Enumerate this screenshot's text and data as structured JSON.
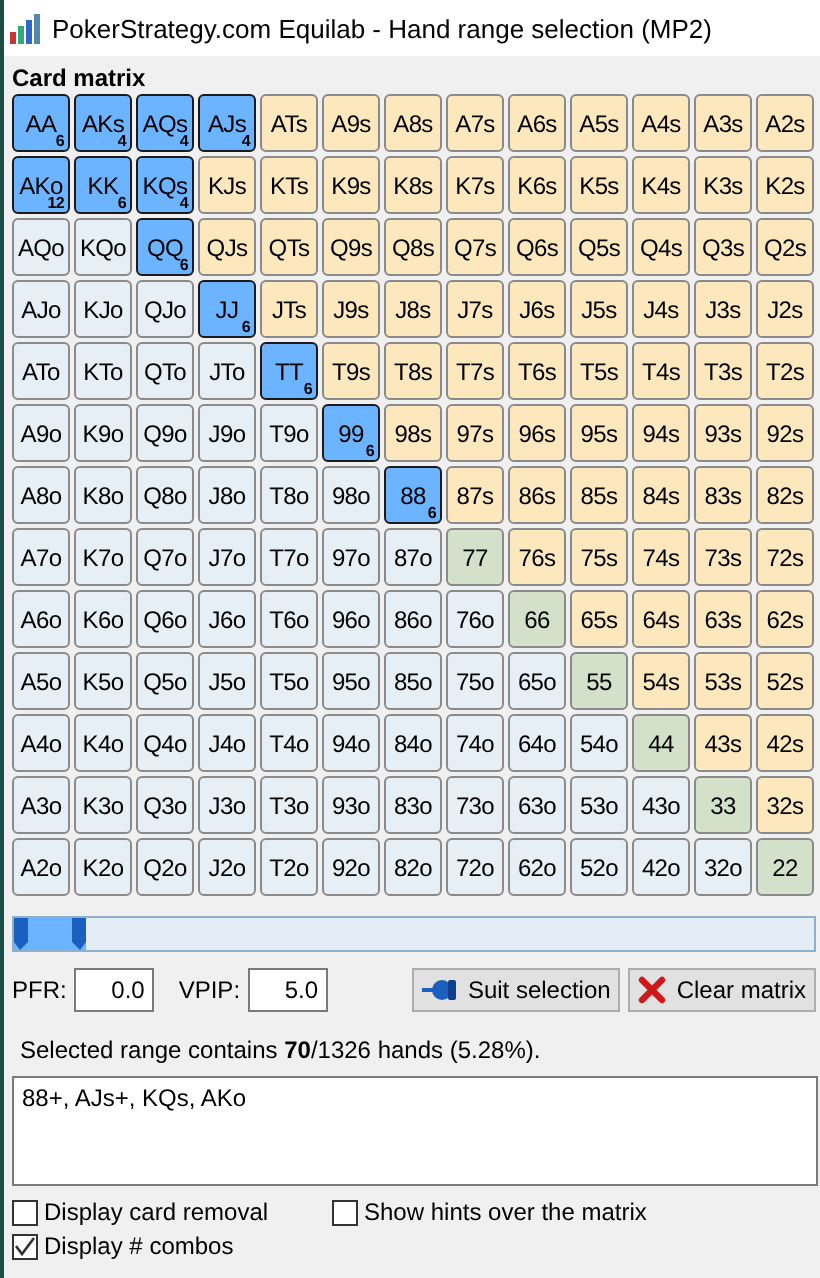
{
  "window": {
    "title": "PokerStrategy.com Equilab - Hand range selection (MP2)"
  },
  "matrix": {
    "heading": "Card matrix",
    "rows": [
      {
        "cells": [
          {
            "label": "AA",
            "kind": "pair",
            "selected": true,
            "combos": "6"
          },
          {
            "label": "AKs",
            "kind": "suited",
            "selected": true,
            "combos": "4"
          },
          {
            "label": "AQs",
            "kind": "suited",
            "selected": true,
            "combos": "4"
          },
          {
            "label": "AJs",
            "kind": "suited",
            "selected": true,
            "combos": "4"
          },
          {
            "label": "ATs",
            "kind": "suited",
            "selected": false
          },
          {
            "label": "A9s",
            "kind": "suited",
            "selected": false
          },
          {
            "label": "A8s",
            "kind": "suited",
            "selected": false
          },
          {
            "label": "A7s",
            "kind": "suited",
            "selected": false
          },
          {
            "label": "A6s",
            "kind": "suited",
            "selected": false
          },
          {
            "label": "A5s",
            "kind": "suited",
            "selected": false
          },
          {
            "label": "A4s",
            "kind": "suited",
            "selected": false
          },
          {
            "label": "A3s",
            "kind": "suited",
            "selected": false
          },
          {
            "label": "A2s",
            "kind": "suited",
            "selected": false
          }
        ]
      },
      {
        "cells": [
          {
            "label": "AKo",
            "kind": "offsuit",
            "selected": true,
            "combos": "12"
          },
          {
            "label": "KK",
            "kind": "pair",
            "selected": true,
            "combos": "6"
          },
          {
            "label": "KQs",
            "kind": "suited",
            "selected": true,
            "combos": "4"
          },
          {
            "label": "KJs",
            "kind": "suited",
            "selected": false
          },
          {
            "label": "KTs",
            "kind": "suited",
            "selected": false
          },
          {
            "label": "K9s",
            "kind": "suited",
            "selected": false
          },
          {
            "label": "K8s",
            "kind": "suited",
            "selected": false
          },
          {
            "label": "K7s",
            "kind": "suited",
            "selected": false
          },
          {
            "label": "K6s",
            "kind": "suited",
            "selected": false
          },
          {
            "label": "K5s",
            "kind": "suited",
            "selected": false
          },
          {
            "label": "K4s",
            "kind": "suited",
            "selected": false
          },
          {
            "label": "K3s",
            "kind": "suited",
            "selected": false
          },
          {
            "label": "K2s",
            "kind": "suited",
            "selected": false
          }
        ]
      },
      {
        "cells": [
          {
            "label": "AQo",
            "kind": "offsuit",
            "selected": false
          },
          {
            "label": "KQo",
            "kind": "offsuit",
            "selected": false
          },
          {
            "label": "QQ",
            "kind": "pair",
            "selected": true,
            "combos": "6"
          },
          {
            "label": "QJs",
            "kind": "suited",
            "selected": false
          },
          {
            "label": "QTs",
            "kind": "suited",
            "selected": false
          },
          {
            "label": "Q9s",
            "kind": "suited",
            "selected": false
          },
          {
            "label": "Q8s",
            "kind": "suited",
            "selected": false
          },
          {
            "label": "Q7s",
            "kind": "suited",
            "selected": false
          },
          {
            "label": "Q6s",
            "kind": "suited",
            "selected": false
          },
          {
            "label": "Q5s",
            "kind": "suited",
            "selected": false
          },
          {
            "label": "Q4s",
            "kind": "suited",
            "selected": false
          },
          {
            "label": "Q3s",
            "kind": "suited",
            "selected": false
          },
          {
            "label": "Q2s",
            "kind": "suited",
            "selected": false
          }
        ]
      },
      {
        "cells": [
          {
            "label": "AJo",
            "kind": "offsuit",
            "selected": false
          },
          {
            "label": "KJo",
            "kind": "offsuit",
            "selected": false
          },
          {
            "label": "QJo",
            "kind": "offsuit",
            "selected": false
          },
          {
            "label": "JJ",
            "kind": "pair",
            "selected": true,
            "combos": "6"
          },
          {
            "label": "JTs",
            "kind": "suited",
            "selected": false
          },
          {
            "label": "J9s",
            "kind": "suited",
            "selected": false
          },
          {
            "label": "J8s",
            "kind": "suited",
            "selected": false
          },
          {
            "label": "J7s",
            "kind": "suited",
            "selected": false
          },
          {
            "label": "J6s",
            "kind": "suited",
            "selected": false
          },
          {
            "label": "J5s",
            "kind": "suited",
            "selected": false
          },
          {
            "label": "J4s",
            "kind": "suited",
            "selected": false
          },
          {
            "label": "J3s",
            "kind": "suited",
            "selected": false
          },
          {
            "label": "J2s",
            "kind": "suited",
            "selected": false
          }
        ]
      },
      {
        "cells": [
          {
            "label": "ATo",
            "kind": "offsuit",
            "selected": false
          },
          {
            "label": "KTo",
            "kind": "offsuit",
            "selected": false
          },
          {
            "label": "QTo",
            "kind": "offsuit",
            "selected": false
          },
          {
            "label": "JTo",
            "kind": "offsuit",
            "selected": false
          },
          {
            "label": "TT",
            "kind": "pair",
            "selected": true,
            "combos": "6"
          },
          {
            "label": "T9s",
            "kind": "suited",
            "selected": false
          },
          {
            "label": "T8s",
            "kind": "suited",
            "selected": false
          },
          {
            "label": "T7s",
            "kind": "suited",
            "selected": false
          },
          {
            "label": "T6s",
            "kind": "suited",
            "selected": false
          },
          {
            "label": "T5s",
            "kind": "suited",
            "selected": false
          },
          {
            "label": "T4s",
            "kind": "suited",
            "selected": false
          },
          {
            "label": "T3s",
            "kind": "suited",
            "selected": false
          },
          {
            "label": "T2s",
            "kind": "suited",
            "selected": false
          }
        ]
      },
      {
        "cells": [
          {
            "label": "A9o",
            "kind": "offsuit",
            "selected": false
          },
          {
            "label": "K9o",
            "kind": "offsuit",
            "selected": false
          },
          {
            "label": "Q9o",
            "kind": "offsuit",
            "selected": false
          },
          {
            "label": "J9o",
            "kind": "offsuit",
            "selected": false
          },
          {
            "label": "T9o",
            "kind": "offsuit",
            "selected": false
          },
          {
            "label": "99",
            "kind": "pair",
            "selected": true,
            "combos": "6"
          },
          {
            "label": "98s",
            "kind": "suited",
            "selected": false
          },
          {
            "label": "97s",
            "kind": "suited",
            "selected": false
          },
          {
            "label": "96s",
            "kind": "suited",
            "selected": false
          },
          {
            "label": "95s",
            "kind": "suited",
            "selected": false
          },
          {
            "label": "94s",
            "kind": "suited",
            "selected": false
          },
          {
            "label": "93s",
            "kind": "suited",
            "selected": false
          },
          {
            "label": "92s",
            "kind": "suited",
            "selected": false
          }
        ]
      },
      {
        "cells": [
          {
            "label": "A8o",
            "kind": "offsuit",
            "selected": false
          },
          {
            "label": "K8o",
            "kind": "offsuit",
            "selected": false
          },
          {
            "label": "Q8o",
            "kind": "offsuit",
            "selected": false
          },
          {
            "label": "J8o",
            "kind": "offsuit",
            "selected": false
          },
          {
            "label": "T8o",
            "kind": "offsuit",
            "selected": false
          },
          {
            "label": "98o",
            "kind": "offsuit",
            "selected": false
          },
          {
            "label": "88",
            "kind": "pair",
            "selected": true,
            "combos": "6"
          },
          {
            "label": "87s",
            "kind": "suited",
            "selected": false
          },
          {
            "label": "86s",
            "kind": "suited",
            "selected": false
          },
          {
            "label": "85s",
            "kind": "suited",
            "selected": false
          },
          {
            "label": "84s",
            "kind": "suited",
            "selected": false
          },
          {
            "label": "83s",
            "kind": "suited",
            "selected": false
          },
          {
            "label": "82s",
            "kind": "suited",
            "selected": false
          }
        ]
      },
      {
        "cells": [
          {
            "label": "A7o",
            "kind": "offsuit",
            "selected": false
          },
          {
            "label": "K7o",
            "kind": "offsuit",
            "selected": false
          },
          {
            "label": "Q7o",
            "kind": "offsuit",
            "selected": false
          },
          {
            "label": "J7o",
            "kind": "offsuit",
            "selected": false
          },
          {
            "label": "T7o",
            "kind": "offsuit",
            "selected": false
          },
          {
            "label": "97o",
            "kind": "offsuit",
            "selected": false
          },
          {
            "label": "87o",
            "kind": "offsuit",
            "selected": false
          },
          {
            "label": "77",
            "kind": "pair",
            "selected": false
          },
          {
            "label": "76s",
            "kind": "suited",
            "selected": false
          },
          {
            "label": "75s",
            "kind": "suited",
            "selected": false
          },
          {
            "label": "74s",
            "kind": "suited",
            "selected": false
          },
          {
            "label": "73s",
            "kind": "suited",
            "selected": false
          },
          {
            "label": "72s",
            "kind": "suited",
            "selected": false
          }
        ]
      },
      {
        "cells": [
          {
            "label": "A6o",
            "kind": "offsuit",
            "selected": false
          },
          {
            "label": "K6o",
            "kind": "offsuit",
            "selected": false
          },
          {
            "label": "Q6o",
            "kind": "offsuit",
            "selected": false
          },
          {
            "label": "J6o",
            "kind": "offsuit",
            "selected": false
          },
          {
            "label": "T6o",
            "kind": "offsuit",
            "selected": false
          },
          {
            "label": "96o",
            "kind": "offsuit",
            "selected": false
          },
          {
            "label": "86o",
            "kind": "offsuit",
            "selected": false
          },
          {
            "label": "76o",
            "kind": "offsuit",
            "selected": false
          },
          {
            "label": "66",
            "kind": "pair",
            "selected": false
          },
          {
            "label": "65s",
            "kind": "suited",
            "selected": false
          },
          {
            "label": "64s",
            "kind": "suited",
            "selected": false
          },
          {
            "label": "63s",
            "kind": "suited",
            "selected": false
          },
          {
            "label": "62s",
            "kind": "suited",
            "selected": false
          }
        ]
      },
      {
        "cells": [
          {
            "label": "A5o",
            "kind": "offsuit",
            "selected": false
          },
          {
            "label": "K5o",
            "kind": "offsuit",
            "selected": false
          },
          {
            "label": "Q5o",
            "kind": "offsuit",
            "selected": false
          },
          {
            "label": "J5o",
            "kind": "offsuit",
            "selected": false
          },
          {
            "label": "T5o",
            "kind": "offsuit",
            "selected": false
          },
          {
            "label": "95o",
            "kind": "offsuit",
            "selected": false
          },
          {
            "label": "85o",
            "kind": "offsuit",
            "selected": false
          },
          {
            "label": "75o",
            "kind": "offsuit",
            "selected": false
          },
          {
            "label": "65o",
            "kind": "offsuit",
            "selected": false
          },
          {
            "label": "55",
            "kind": "pair",
            "selected": false
          },
          {
            "label": "54s",
            "kind": "suited",
            "selected": false
          },
          {
            "label": "53s",
            "kind": "suited",
            "selected": false
          },
          {
            "label": "52s",
            "kind": "suited",
            "selected": false
          }
        ]
      },
      {
        "cells": [
          {
            "label": "A4o",
            "kind": "offsuit",
            "selected": false
          },
          {
            "label": "K4o",
            "kind": "offsuit",
            "selected": false
          },
          {
            "label": "Q4o",
            "kind": "offsuit",
            "selected": false
          },
          {
            "label": "J4o",
            "kind": "offsuit",
            "selected": false
          },
          {
            "label": "T4o",
            "kind": "offsuit",
            "selected": false
          },
          {
            "label": "94o",
            "kind": "offsuit",
            "selected": false
          },
          {
            "label": "84o",
            "kind": "offsuit",
            "selected": false
          },
          {
            "label": "74o",
            "kind": "offsuit",
            "selected": false
          },
          {
            "label": "64o",
            "kind": "offsuit",
            "selected": false
          },
          {
            "label": "54o",
            "kind": "offsuit",
            "selected": false
          },
          {
            "label": "44",
            "kind": "pair",
            "selected": false
          },
          {
            "label": "43s",
            "kind": "suited",
            "selected": false
          },
          {
            "label": "42s",
            "kind": "suited",
            "selected": false
          }
        ]
      },
      {
        "cells": [
          {
            "label": "A3o",
            "kind": "offsuit",
            "selected": false
          },
          {
            "label": "K3o",
            "kind": "offsuit",
            "selected": false
          },
          {
            "label": "Q3o",
            "kind": "offsuit",
            "selected": false
          },
          {
            "label": "J3o",
            "kind": "offsuit",
            "selected": false
          },
          {
            "label": "T3o",
            "kind": "offsuit",
            "selected": false
          },
          {
            "label": "93o",
            "kind": "offsuit",
            "selected": false
          },
          {
            "label": "83o",
            "kind": "offsuit",
            "selected": false
          },
          {
            "label": "73o",
            "kind": "offsuit",
            "selected": false
          },
          {
            "label": "63o",
            "kind": "offsuit",
            "selected": false
          },
          {
            "label": "53o",
            "kind": "offsuit",
            "selected": false
          },
          {
            "label": "43o",
            "kind": "offsuit",
            "selected": false
          },
          {
            "label": "33",
            "kind": "pair",
            "selected": false
          },
          {
            "label": "32s",
            "kind": "suited",
            "selected": false
          }
        ]
      },
      {
        "cells": [
          {
            "label": "A2o",
            "kind": "offsuit",
            "selected": false
          },
          {
            "label": "K2o",
            "kind": "offsuit",
            "selected": false
          },
          {
            "label": "Q2o",
            "kind": "offsuit",
            "selected": false
          },
          {
            "label": "J2o",
            "kind": "offsuit",
            "selected": false
          },
          {
            "label": "T2o",
            "kind": "offsuit",
            "selected": false
          },
          {
            "label": "92o",
            "kind": "offsuit",
            "selected": false
          },
          {
            "label": "82o",
            "kind": "offsuit",
            "selected": false
          },
          {
            "label": "72o",
            "kind": "offsuit",
            "selected": false
          },
          {
            "label": "62o",
            "kind": "offsuit",
            "selected": false
          },
          {
            "label": "52o",
            "kind": "offsuit",
            "selected": false
          },
          {
            "label": "42o",
            "kind": "offsuit",
            "selected": false
          },
          {
            "label": "32o",
            "kind": "offsuit",
            "selected": false
          },
          {
            "label": "22",
            "kind": "pair",
            "selected": false
          }
        ]
      }
    ]
  },
  "range_slider": {
    "level": 0.09
  },
  "fields": [
    {
      "label": "PFR:",
      "value": "0.0"
    },
    {
      "label": "VPIP:",
      "value": "5.0"
    }
  ],
  "buttons": [
    {
      "kind": "suit",
      "label": "Suit selection"
    },
    {
      "kind": "clear",
      "label": "Clear matrix"
    }
  ],
  "summary": "Selected range contains **70**/1326 hands (5.28%).",
  "range_text": "88+, AJs+, KQs, AKo",
  "options": [
    {
      "label": "Display card removal",
      "checked": false
    },
    {
      "label": "Show hints over the matrix",
      "checked": false
    },
    {
      "label": "Display # combos",
      "checked": true
    }
  ]
}
